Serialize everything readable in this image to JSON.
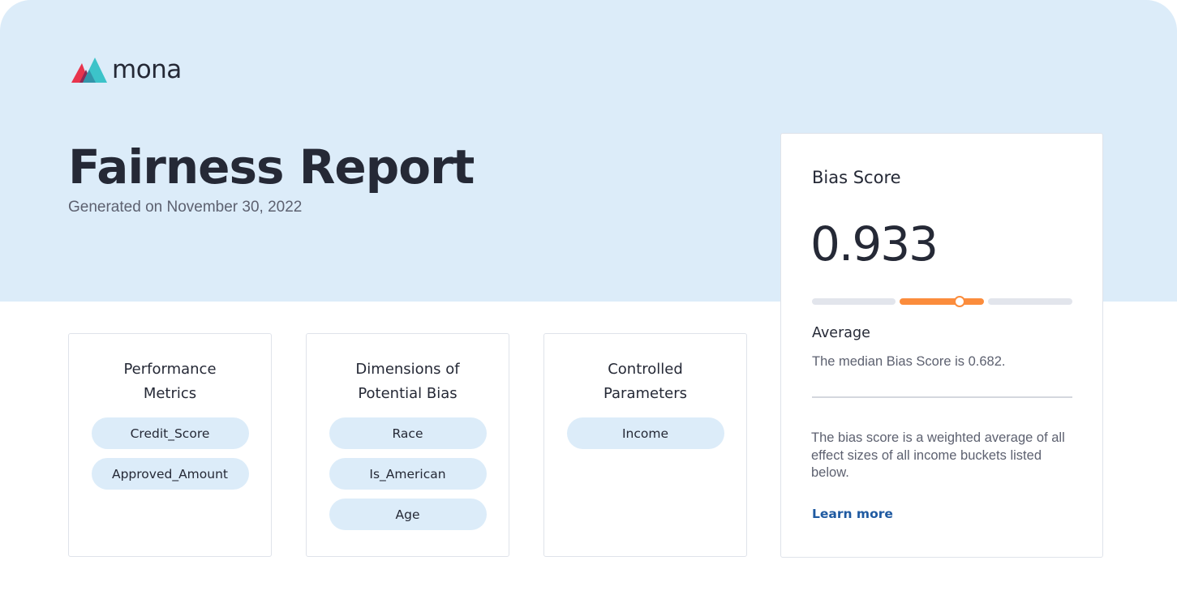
{
  "brand": {
    "name": "mona"
  },
  "header": {
    "title": "Fairness Report",
    "subtitle": "Generated on November 30, 2022"
  },
  "cards": [
    {
      "title_lines": [
        "Performance",
        "Metrics"
      ],
      "pills": [
        "Credit_Score",
        "Approved_Amount"
      ]
    },
    {
      "title_lines": [
        "Dimensions of",
        "Potential Bias"
      ],
      "pills": [
        "Race",
        "Is_American",
        "Age"
      ]
    },
    {
      "title_lines": [
        "Controlled",
        "Parameters"
      ],
      "pills": [
        "Income"
      ]
    }
  ],
  "bias": {
    "title": "Bias Score",
    "value": "0.933",
    "level": "Average",
    "median_text": "The median Bias Score is 0.682.",
    "description": "The bias score is a weighted average of all effect sizes of all income buckets listed below.",
    "learn_more": "Learn more",
    "gauge": {
      "segments": 3,
      "active_segment": 2,
      "marker_fraction_in_segment": 0.71
    }
  },
  "colors": {
    "hero_background": "#dcecf9",
    "pill_background": "#dcecf9",
    "accent_orange": "#fb8c3c",
    "link_blue": "#1f5aa1",
    "text_dark": "#252936",
    "text_muted": "#5d6170"
  },
  "icons": {
    "logo": "mona-mountain-logo-icon"
  }
}
